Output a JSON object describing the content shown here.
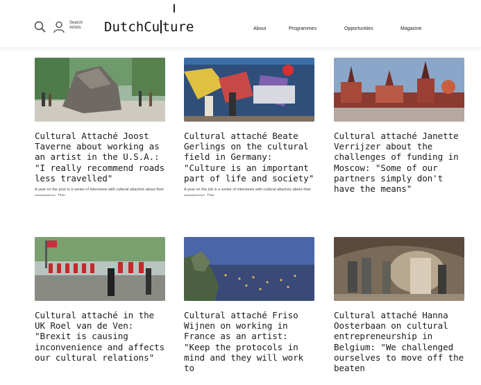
{
  "header": {
    "search_label_line1": "Search",
    "search_label_line2": "Artists",
    "logo_left": "DutchCu",
    "logo_right": "ture",
    "nav": [
      {
        "label": "About"
      },
      {
        "label": "Programmes"
      },
      {
        "label": "Opportunities"
      },
      {
        "label": "Magazine"
      }
    ]
  },
  "articles": [
    {
      "title": "Cultural Attaché Joost Taverne about working as an artist in the U.S.A.: \"I really recommend roads less travelled\"",
      "excerpt": "A year on the post is a series of interviews with cultural attachés about their experiences. This",
      "image": "fallen-head-sculpture"
    },
    {
      "title": "Cultural attaché Beate Gerlings on the cultural field in Germany: \"Culture is an important part of life and society\"",
      "excerpt": "A year on the job is a series of interviews with cultural attachés about their experiences. This",
      "image": "berlin-wall-graffiti"
    },
    {
      "title": "Cultural attaché Janette Verrijzer about the challenges of funding in Moscow: \"Some of our partners simply don't have the means\"",
      "excerpt": "",
      "image": "moscow-red-square"
    },
    {
      "title": "Cultural attaché in the UK Roel van de Ven: \"Brexit is causing inconvenience and affects our cultural relations\"",
      "excerpt": "",
      "image": "london-guards-parade"
    },
    {
      "title": "Cultural attaché Friso Wijnen on working in France as an artist: \"Keep the protocols in mind and they will work to",
      "excerpt": "",
      "image": "paris-gargoyle-view"
    },
    {
      "title": "Cultural attaché Hanna Oosterbaan on cultural entrepreneurship in Belgium: \"We challenged ourselves to move off the beaten",
      "excerpt": "",
      "image": "cave-sculptures"
    }
  ]
}
